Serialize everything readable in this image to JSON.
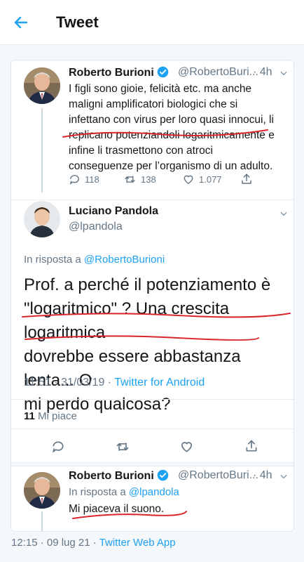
{
  "header": {
    "title": "Tweet"
  },
  "tweet1": {
    "name": "Roberto Burioni",
    "handle": "@RobertoBuri...",
    "time": "4h",
    "lines": [
      "I figli sono gioie, felicità etc. ma anche",
      "maligni amplificatori biologici che si",
      "infettano con virus per loro quasi innocui, li",
      "replicano potenziandoli logaritmicamente e",
      "infine li trasmettono con atroci",
      "conseguenze per l’organismo di un adulto."
    ],
    "replies": "118",
    "retweets": "138",
    "likes": "1.077"
  },
  "main_tweet": {
    "name": "Luciano Pandola",
    "handle": "@lpandola",
    "reply_prefix": "In risposta a ",
    "reply_to": "@RobertoBurioni",
    "lines": [
      "Prof. a perché il potenziamento è",
      "\"logaritmico\" ? Una crescita logaritmica",
      "dovrebbe essere abbastanza lenta... O",
      "mi perdo qualcosa?"
    ],
    "timestamp": "11:51 · 31/03/19 · ",
    "source": "Twitter for Android",
    "likes_count": "11",
    "likes_label": " Mi piace"
  },
  "reply": {
    "name": "Roberto Burioni",
    "handle": "@RobertoBuri...",
    "time": "4h",
    "reply_prefix": "In risposta a ",
    "reply_to": "@lpandola",
    "text": "Mi piaceva il suono."
  },
  "footer": {
    "timestamp": "12:15 · 09 lug 21 · ",
    "source": "Twitter Web App"
  },
  "colors": {
    "accent": "#1da1f2",
    "annotation": "#d9262c",
    "muted": "#657786"
  }
}
